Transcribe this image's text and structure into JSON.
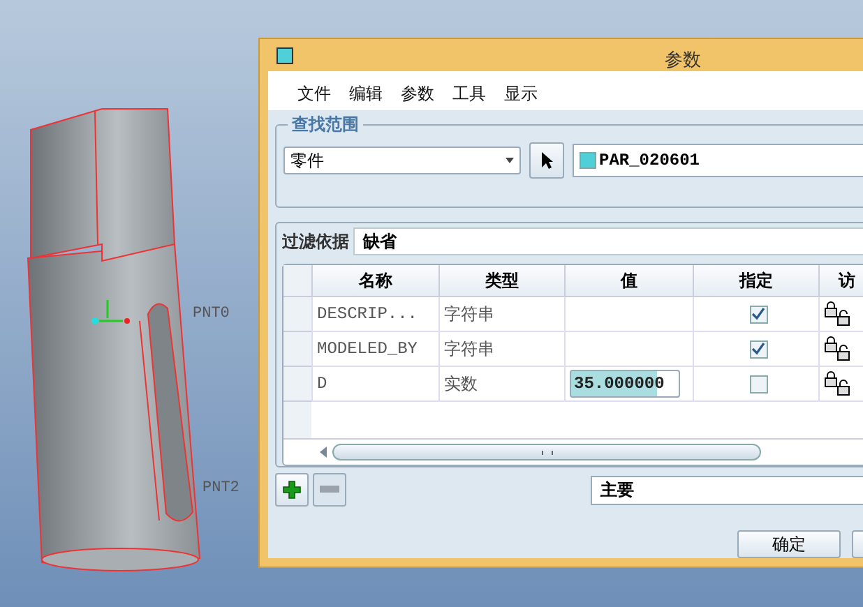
{
  "viewport": {
    "labels": [
      {
        "text": "PNT0",
        "kind": "top"
      },
      {
        "text": "PNT2",
        "kind": "bottom"
      }
    ]
  },
  "window": {
    "title": "参数"
  },
  "menu": [
    "文件",
    "编辑",
    "参数",
    "工具",
    "显示"
  ],
  "scope": {
    "label": "查找范围",
    "dropdown": "零件",
    "model": "PAR_020601"
  },
  "filter": {
    "label": "过滤依据",
    "value": "缺省"
  },
  "table": {
    "columns": [
      "名称",
      "类型",
      "值",
      "指定",
      "访"
    ],
    "rows": [
      {
        "name": "DESCRIP...",
        "type": "字符串",
        "designated": true
      },
      {
        "name": "MODELED_BY",
        "type": "字符串",
        "designated": true
      },
      {
        "name": "D",
        "type": "实数",
        "value": "35.000000",
        "editing": true,
        "designated": false
      }
    ]
  },
  "add_remove": {
    "remove_disabled": true
  },
  "set": {
    "value": "主要"
  },
  "buttons": [
    "确定"
  ]
}
